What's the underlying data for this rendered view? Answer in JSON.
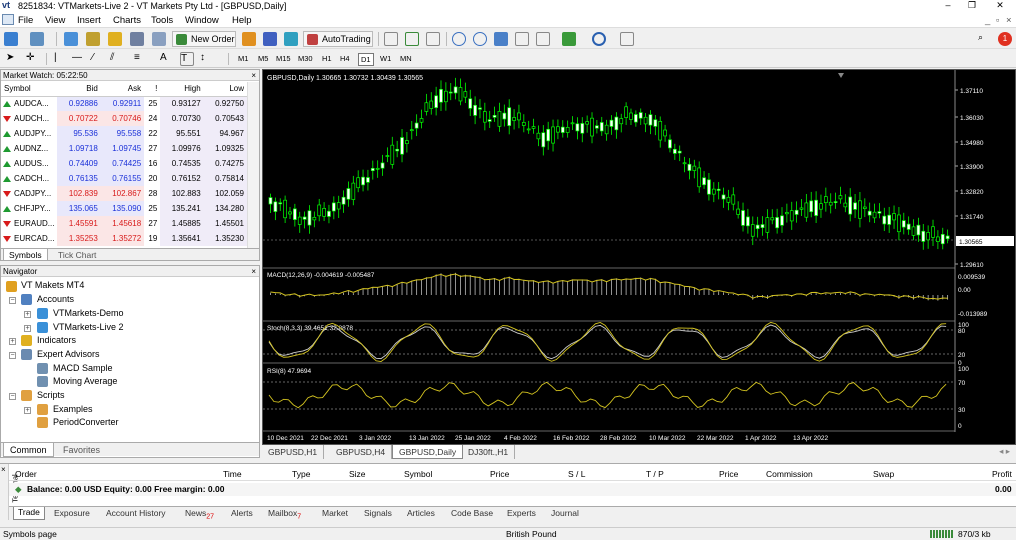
{
  "window": {
    "logo": "vt",
    "title": "8251834: VTMarkets-Live 2 - VT Markets Pty Ltd - [GBPUSD,Daily]"
  },
  "menu": [
    "File",
    "View",
    "Insert",
    "Charts",
    "Tools",
    "Window",
    "Help"
  ],
  "toolbar": {
    "new_order": "New Order",
    "autotrading": "AutoTrading",
    "timeframes": [
      "M1",
      "M5",
      "M15",
      "M30",
      "H1",
      "H4",
      "D1",
      "W1",
      "MN"
    ],
    "selected_timeframe": "D1",
    "notification_count": "1"
  },
  "market_watch": {
    "title": "Market Watch: 05:22:50",
    "columns": [
      "Symbol",
      "Bid",
      "Ask",
      "!",
      "High",
      "Low"
    ],
    "rows": [
      {
        "symbol": "AUDCA...",
        "dir": "up",
        "bid": "0.92886",
        "ask": "0.92911",
        "spread": "25",
        "high": "0.93127",
        "low": "0.92750"
      },
      {
        "symbol": "AUDCH...",
        "dir": "dn",
        "bid": "0.70722",
        "ask": "0.70746",
        "spread": "24",
        "high": "0.70730",
        "low": "0.70543"
      },
      {
        "symbol": "AUDJPY...",
        "dir": "up",
        "bid": "95.536",
        "ask": "95.558",
        "spread": "22",
        "high": "95.551",
        "low": "94.967"
      },
      {
        "symbol": "AUDNZ...",
        "dir": "up",
        "bid": "1.09718",
        "ask": "1.09745",
        "spread": "27",
        "high": "1.09976",
        "low": "1.09325"
      },
      {
        "symbol": "AUDUS...",
        "dir": "up",
        "bid": "0.74409",
        "ask": "0.74425",
        "spread": "16",
        "high": "0.74535",
        "low": "0.74275"
      },
      {
        "symbol": "CADCH...",
        "dir": "up",
        "bid": "0.76135",
        "ask": "0.76155",
        "spread": "20",
        "high": "0.76152",
        "low": "0.75814"
      },
      {
        "symbol": "CADJPY...",
        "dir": "dn",
        "bid": "102.839",
        "ask": "102.867",
        "spread": "28",
        "high": "102.883",
        "low": "102.059"
      },
      {
        "symbol": "CHFJPY...",
        "dir": "up",
        "bid": "135.065",
        "ask": "135.090",
        "spread": "25",
        "high": "135.241",
        "low": "134.280"
      },
      {
        "symbol": "EURAUD...",
        "dir": "dn",
        "bid": "1.45591",
        "ask": "1.45618",
        "spread": "27",
        "high": "1.45885",
        "low": "1.45501"
      },
      {
        "symbol": "EURCAD...",
        "dir": "dn",
        "bid": "1.35253",
        "ask": "1.35272",
        "spread": "19",
        "high": "1.35641",
        "low": "1.35230"
      }
    ],
    "tabs": [
      "Symbols",
      "Tick Chart"
    ]
  },
  "navigator": {
    "title": "Navigator",
    "items": {
      "root": "VT Makets MT4",
      "accounts": "Accounts",
      "demo": "VTMarkets-Demo",
      "live": "VTMarkets-Live 2",
      "indicators": "Indicators",
      "experts": "Expert Advisors",
      "macd": "MACD Sample",
      "ma": "Moving Average",
      "scripts": "Scripts",
      "examples": "Examples",
      "period": "PeriodConverter"
    },
    "tabs": [
      "Common",
      "Favorites"
    ]
  },
  "chart": {
    "header": "GBPUSD,Daily  1.30665 1.30732 1.30439 1.30565",
    "price_labels": [
      "1.37110",
      "1.36030",
      "1.34980",
      "1.33900",
      "1.32820",
      "1.31740",
      "1.29610"
    ],
    "current_price": "1.30565",
    "macd_label": "MACD(12,26,9) -0.004619 -0.005487",
    "macd_labels": [
      "0.009539",
      "0.00",
      "-0.013989"
    ],
    "stoch_label": "Stoch(8,3,3) 39.4651 32.8878",
    "stoch_labels": [
      "100",
      "80",
      "20",
      "0"
    ],
    "rsi_label": "RSI(8) 47.9694",
    "rsi_labels": [
      "100",
      "70",
      "30",
      "0"
    ],
    "dates": [
      "10 Dec 2021",
      "22 Dec 2021",
      "3 Jan 2022",
      "13 Jan 2022",
      "25 Jan 2022",
      "4 Feb 2022",
      "16 Feb 2022",
      "28 Feb 2022",
      "10 Mar 2022",
      "22 Mar 2022",
      "1 Apr 2022",
      "13 Apr 2022"
    ],
    "tabs": [
      "GBPUSD,H1",
      "GBPUSD,H4",
      "GBPUSD,Daily",
      "DJ30ft.,H1"
    ],
    "active_tab": "GBPUSD,Daily",
    "colors": {
      "bg": "#000000",
      "candle": "#00ff00",
      "bear": "#ffffff",
      "indicator": "#d4c420"
    }
  },
  "terminal": {
    "side_label": "Terminal",
    "columns": [
      "Order",
      "Time",
      "Type",
      "Size",
      "Symbol",
      "Price",
      "S / L",
      "T / P",
      "Price",
      "Commission",
      "Swap",
      "Profit"
    ],
    "balance_text": "Balance: 0.00 USD  Equity: 0.00  Free margin: 0.00",
    "profit_value": "0.00",
    "tabs": {
      "trade": "Trade",
      "exposure": "Exposure",
      "history": "Account History",
      "news": "News",
      "news_badge": "27",
      "alerts": "Alerts",
      "mailbox": "Mailbox",
      "mailbox_badge": "7",
      "market": "Market",
      "signals": "Signals",
      "articles": "Articles",
      "codebase": "Code Base",
      "experts": "Experts",
      "journal": "Journal"
    }
  },
  "status": {
    "left": "Symbols page",
    "middle": "British Pound",
    "right": "870/3 kb"
  }
}
